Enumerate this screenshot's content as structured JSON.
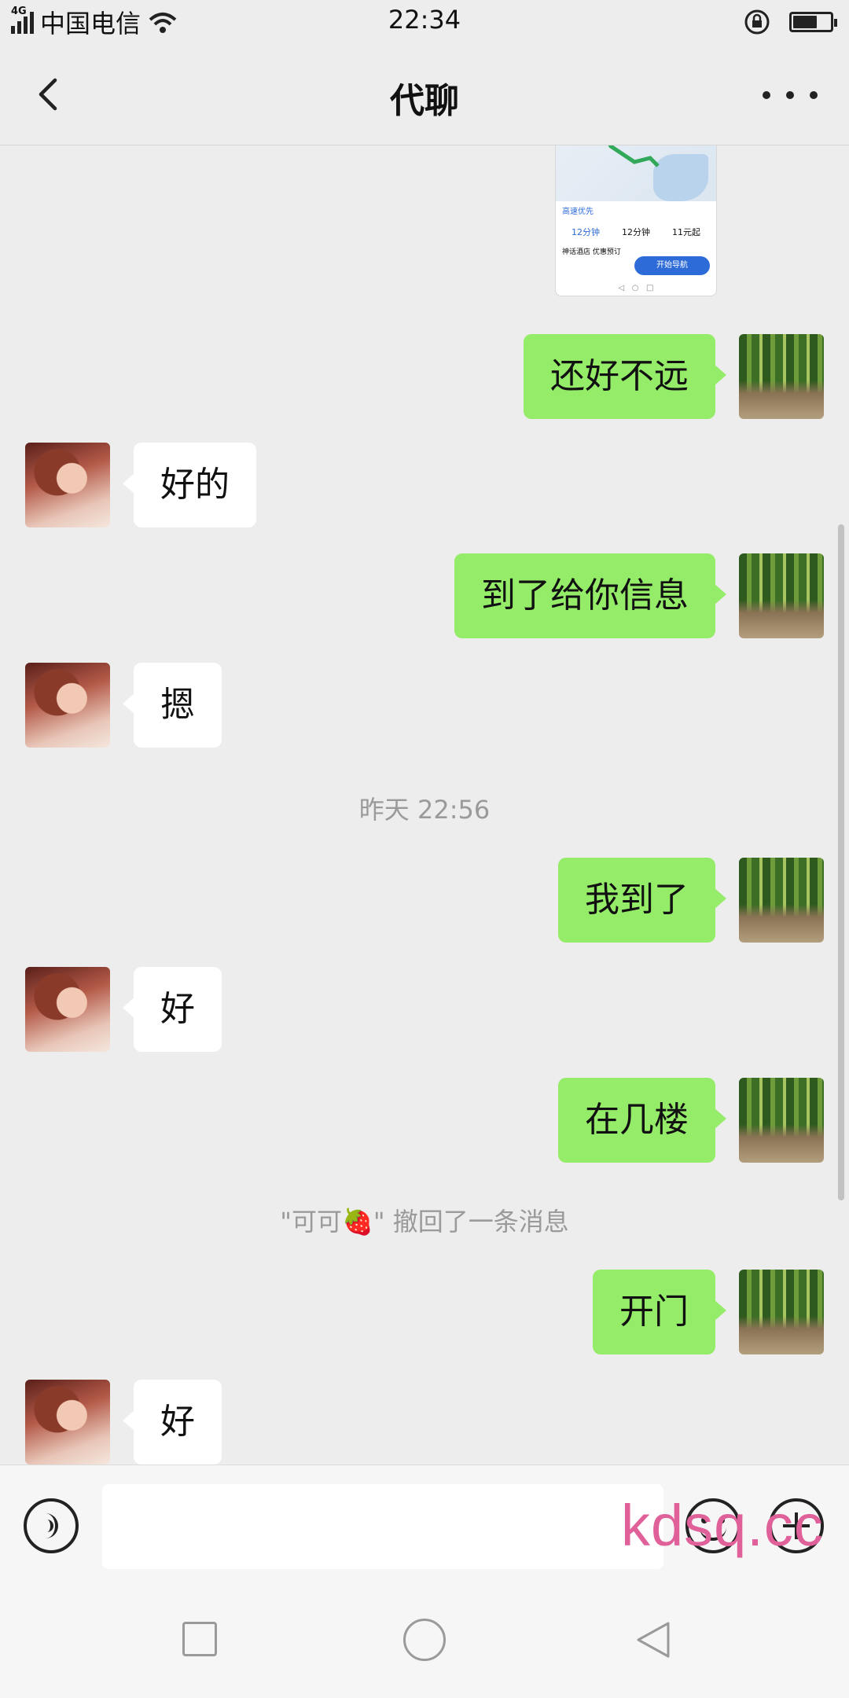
{
  "status_bar": {
    "network": "4G",
    "carrier": "中国电信",
    "time": "22:34",
    "battery_level": 0.6
  },
  "header": {
    "title": "代聊"
  },
  "map_card": {
    "label_source": "高速优先",
    "options": [
      "12分钟",
      "12分钟",
      "11元起"
    ],
    "hotel_line": "神话酒店 优惠预订",
    "nav_button": "开始导航"
  },
  "messages": [
    {
      "side": "mine",
      "text": "还好不远"
    },
    {
      "side": "theirs",
      "text": "好的"
    },
    {
      "side": "mine",
      "text": "到了给你信息"
    },
    {
      "side": "theirs",
      "text": "摁"
    },
    {
      "side": "mine",
      "text": "我到了"
    },
    {
      "side": "theirs",
      "text": "好"
    },
    {
      "side": "mine",
      "text": "在几楼"
    },
    {
      "side": "mine",
      "text": "开门"
    },
    {
      "side": "theirs",
      "text": "好"
    }
  ],
  "system_messages": {
    "timestamp": "昨天 22:56",
    "recall_notice": "\"可可🍓\" 撤回了一条消息"
  },
  "input_bar": {
    "value": "",
    "voice_icon": "voice-icon",
    "emoji_icon": "emoji-icon",
    "plus_icon": "plus-icon"
  },
  "watermark": "kdsq.cc",
  "colors": {
    "background": "#ededed",
    "mine_bubble": "#95ec69",
    "theirs_bubble": "#ffffff",
    "watermark": "#e0609a"
  }
}
